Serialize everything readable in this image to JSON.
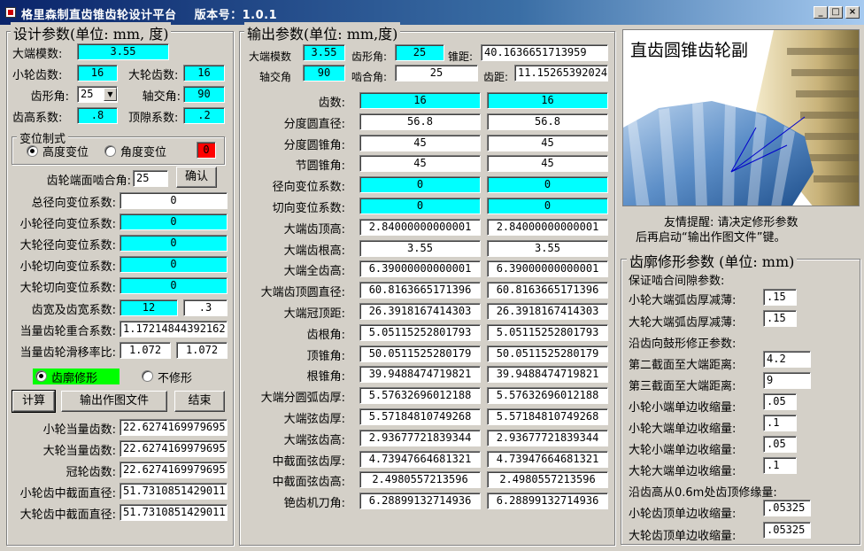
{
  "window": {
    "title": "格里森制直齿锥齿轮设计平台    版本号：1.0.1",
    "min": "_",
    "max": "□",
    "close": "×"
  },
  "design": {
    "title": "设计参数(单位: mm, 度)",
    "module_label": "大端模数:",
    "module": "3.55",
    "z1_label": "小轮齿数:",
    "z1": "16",
    "z2_label": "大轮齿数:",
    "z2": "16",
    "alpha_label": "齿形角:",
    "alpha": "25",
    "sigma_label": "轴交角:",
    "sigma": "90",
    "ha_label": "齿高系数:",
    "ha": ".8",
    "c_label": "顶隙系数:",
    "c": ".2",
    "shift_group": "变位制式",
    "shift_opt1": "高度变位",
    "shift_opt2": "角度变位",
    "shift_val": "0",
    "face_angle_label": "齿轮端面啮合角:",
    "face_angle": "25",
    "confirm": "确认",
    "total_x_label": "总径向变位系数:",
    "total_x": "0",
    "x1_label": "小轮径向变位系数:",
    "x1": "0",
    "x2_label": "大轮径向变位系数:",
    "x2": "0",
    "xt1_label": "小轮切向变位系数:",
    "xt1": "0",
    "xt2_label": "大轮切向变位系数:",
    "xt2": "0",
    "width_label": "齿宽及齿宽系数:",
    "width": "12",
    "width_coef": ".3",
    "eps_label": "当量齿轮重合系数:",
    "eps": "1.17214844392162",
    "slip_label": "当量齿轮滑移率比:",
    "slip1": "1.072",
    "slip2": "1.072",
    "mod_opt1": "齿廓修形",
    "mod_opt2": "不修形",
    "calc": "计算",
    "export": "输出作图文件",
    "end": "结束",
    "zv1_label": "小轮当量齿数:",
    "zv1": "22.6274169979695",
    "zv2_label": "大轮当量齿数:",
    "zv2": "22.6274169979695",
    "crown_label": "冠轮齿数:",
    "crown": "22.6274169979695",
    "d1m_label": "小轮齿中截面直径:",
    "d1m": "51.7310851429011",
    "d2m_label": "大轮齿中截面直径:",
    "d2m": "51.7310851429011"
  },
  "output": {
    "title": "输出参数(单位: mm,度)",
    "m_label": "大端模数",
    "m": "3.55",
    "alpha_label": "齿形角:",
    "alpha": "25",
    "R_label": "锥距:",
    "R": "40.1636651713959",
    "sigma_label": "轴交角",
    "sigma": "90",
    "mesh_label": "啮合角:",
    "mesh": "25",
    "pitch_label": "齿距:",
    "pitch": "11.15265392024",
    "rows": [
      {
        "label": "齿数:",
        "a": "16",
        "b": "16",
        "cyan": true
      },
      {
        "label": "分度圆直径:",
        "a": "56.8",
        "b": "56.8",
        "cyan": false
      },
      {
        "label": "分度圆锥角:",
        "a": "45",
        "b": "45",
        "cyan": false
      },
      {
        "label": "节圆锥角:",
        "a": "45",
        "b": "45",
        "cyan": false
      },
      {
        "label": "径向变位系数:",
        "a": "0",
        "b": "0",
        "cyan": true
      },
      {
        "label": "切向变位系数:",
        "a": "0",
        "b": "0",
        "cyan": true
      },
      {
        "label": "大端齿顶高:",
        "a": "2.84000000000001",
        "b": "2.84000000000001",
        "cyan": false
      },
      {
        "label": "大端齿根高:",
        "a": "3.55",
        "b": "3.55",
        "cyan": false
      },
      {
        "label": "大端全齿高:",
        "a": "6.39000000000001",
        "b": "6.39000000000001",
        "cyan": false
      },
      {
        "label": "大端齿顶圆直径:",
        "a": "60.8163665171396",
        "b": "60.8163665171396",
        "cyan": false
      },
      {
        "label": "大端冠顶距:",
        "a": "26.3918167414303",
        "b": "26.3918167414303",
        "cyan": false
      },
      {
        "label": "齿根角:",
        "a": "5.05115252801793",
        "b": "5.05115252801793",
        "cyan": false
      },
      {
        "label": "顶锥角:",
        "a": "50.0511525280179",
        "b": "50.0511525280179",
        "cyan": false
      },
      {
        "label": "根锥角:",
        "a": "39.9488474719821",
        "b": "39.9488474719821",
        "cyan": false
      },
      {
        "label": "大端分圆弧齿厚:",
        "a": "5.57632696012188",
        "b": "5.57632696012188",
        "cyan": false
      },
      {
        "label": "大端弦齿厚:",
        "a": "5.57184810749268",
        "b": "5.57184810749268",
        "cyan": false
      },
      {
        "label": "大端弦齿高:",
        "a": "2.93677721839344",
        "b": "2.93677721839344",
        "cyan": false
      },
      {
        "label": "中截面弦齿厚:",
        "a": "4.73947664681321",
        "b": "4.73947664681321",
        "cyan": false
      },
      {
        "label": "中截面弦齿高:",
        "a": "2.4980557213596",
        "b": "2.4980557213596",
        "cyan": false
      },
      {
        "label": "铯齿机刀角:",
        "a": "6.28899132714936",
        "b": "6.28899132714936",
        "cyan": false
      }
    ]
  },
  "right": {
    "pic_title": "直齿圆锥齿轮副",
    "hint1": "友情提醒: 请决定修形参数",
    "hint2": "后再启动“输出作图文件”键。",
    "mod_title": "齿廓修形参数 (单位: mm)",
    "sec1": "保证啮合间隙参数:",
    "r1_label": "小轮大端弧齿厚减薄:",
    "r1": ".15",
    "r2_label": "大轮大端弧齿厚减薄:",
    "r2": ".15",
    "sec2": "沿齿向鼓形修正参数:",
    "r3_label": "第二截面至大端距离:",
    "r3": "4.2",
    "r4_label": "第三截面至大端距离:",
    "r4": "9",
    "r5_label": "小轮小端单边收缩量:",
    "r5": ".05",
    "r6_label": "小轮大端单边收缩量:",
    "r6": ".1",
    "r7_label": "大轮小端单边收缩量:",
    "r7": ".05",
    "r8_label": "大轮大端单边收缩量:",
    "r8": ".1",
    "sec3": "沿齿高从0.6m处齿顶修缘量:",
    "r9_label": "小轮齿顶单边收缩量:",
    "r9": ".05325",
    "r10_label": "大轮齿顶单边收缩量:",
    "r10": ".05325"
  },
  "colors": {
    "cyan": "#00ffff",
    "red": "#ff0000",
    "green": "#00ff00",
    "title": "#0a246a"
  }
}
